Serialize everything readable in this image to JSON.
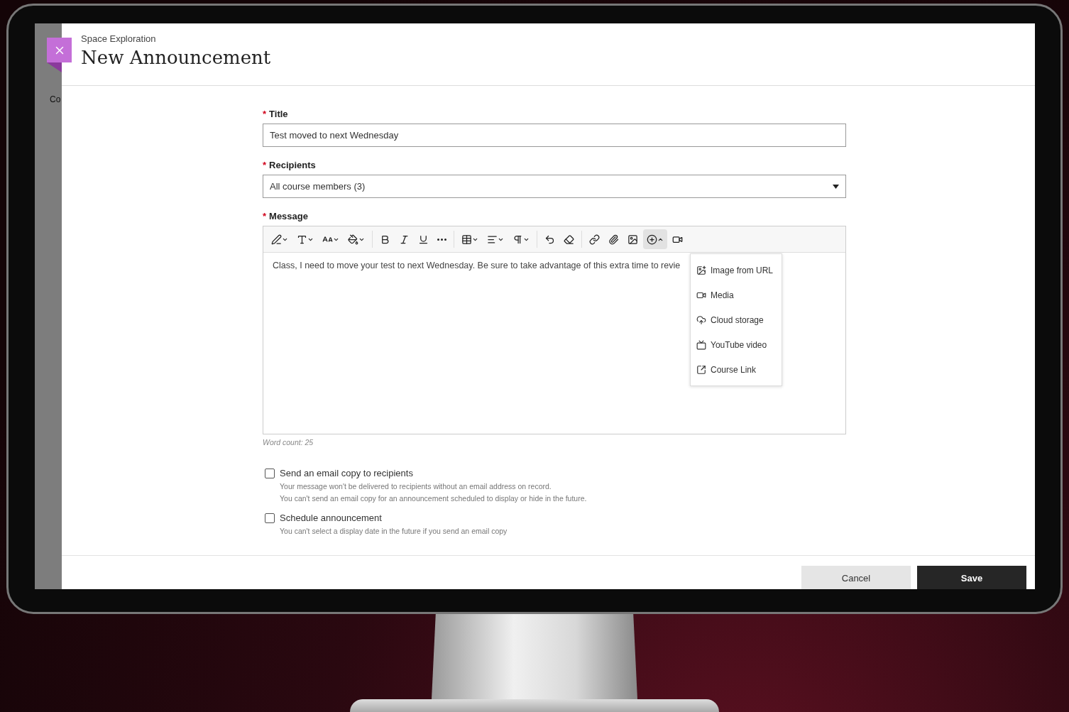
{
  "sidebar": {
    "items": [
      "Co"
    ]
  },
  "header": {
    "course": "Space Exploration",
    "title": "New Announcement"
  },
  "form": {
    "title": {
      "label": "Title",
      "required_mark": "*",
      "value": "Test moved to next Wednesday"
    },
    "recipients": {
      "label": "Recipients",
      "required_mark": "*",
      "value": "All course members (3)"
    },
    "message": {
      "label": "Message",
      "required_mark": "*",
      "body": "Class, I need to move your test to next Wednesday. Be sure to take advantage of this extra time to revie",
      "toolbar": [
        {
          "kind": "text-style",
          "expanded": false
        },
        {
          "kind": "paragraph-format",
          "expanded": false
        },
        {
          "kind": "font-size",
          "expanded": false
        },
        {
          "kind": "highlight",
          "expanded": false
        },
        {
          "kind": "separator"
        },
        {
          "kind": "bold"
        },
        {
          "kind": "italic"
        },
        {
          "kind": "underline"
        },
        {
          "kind": "more"
        },
        {
          "kind": "separator"
        },
        {
          "kind": "table",
          "expanded": false
        },
        {
          "kind": "align",
          "expanded": false
        },
        {
          "kind": "paragraph",
          "expanded": false
        },
        {
          "kind": "separator"
        },
        {
          "kind": "undo"
        },
        {
          "kind": "eraser"
        },
        {
          "kind": "separator"
        },
        {
          "kind": "link"
        },
        {
          "kind": "attach"
        },
        {
          "kind": "image"
        },
        {
          "kind": "insert",
          "expanded": true
        },
        {
          "kind": "video"
        }
      ],
      "menu": [
        {
          "kind": "image-url",
          "label": "Image from URL"
        },
        {
          "kind": "media",
          "label": "Media"
        },
        {
          "kind": "cloud",
          "label": "Cloud storage"
        },
        {
          "kind": "youtube",
          "label": "YouTube video"
        },
        {
          "kind": "course-link",
          "label": "Course Link"
        }
      ],
      "word_count": "Word count: 25"
    },
    "options": [
      {
        "label": "Send an email copy to recipients",
        "checked": false,
        "notes": [
          "Your message won't be delivered to recipients without an email address on record.",
          "You can't send an email copy for an announcement scheduled to display or hide in the future."
        ]
      },
      {
        "label": "Schedule announcement",
        "checked": false,
        "notes": [
          "You can't select a display date in the future if you send an email copy"
        ]
      }
    ]
  },
  "footer": {
    "buttons": [
      {
        "label": "Cancel",
        "kind": "secondary"
      },
      {
        "label": "Save",
        "kind": "primary"
      }
    ]
  }
}
